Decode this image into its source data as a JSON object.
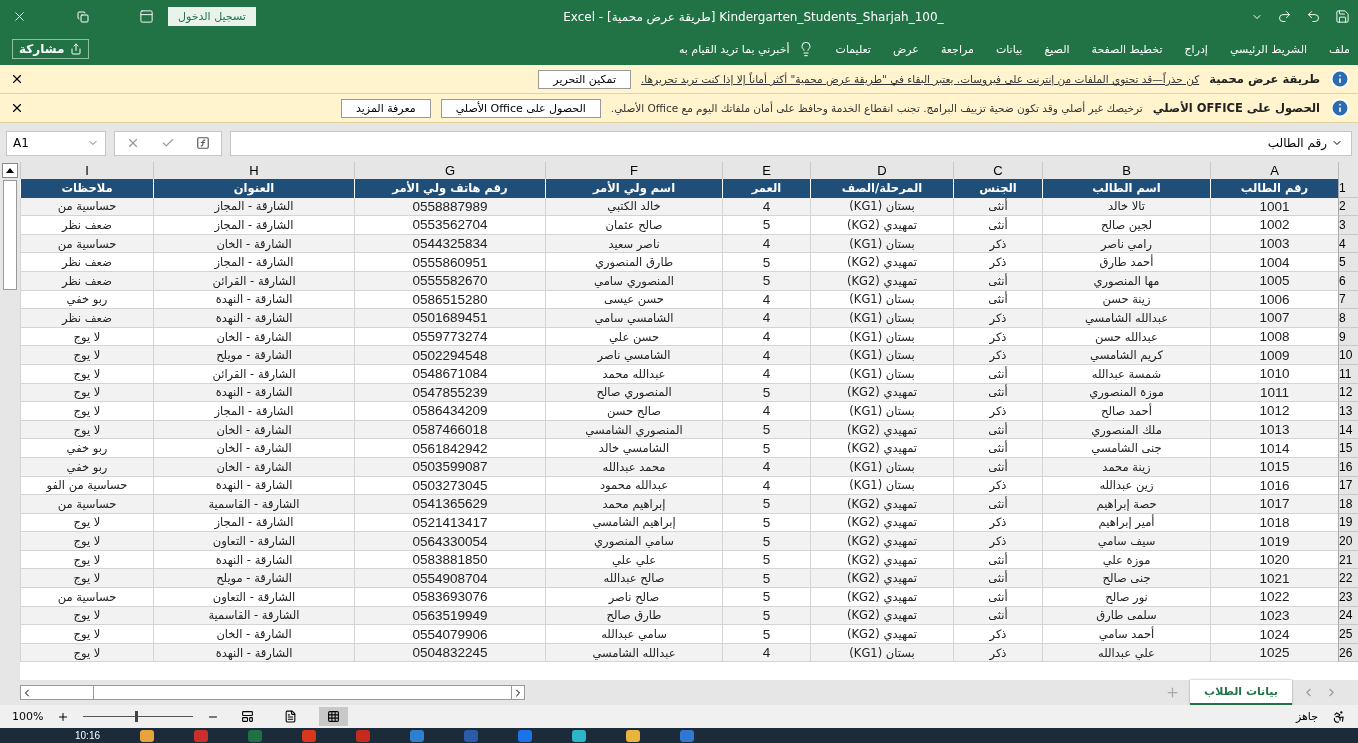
{
  "window": {
    "title": "Excel - [طريقة عرض محمية] Kindergarten_Students_Sharjah_100_",
    "sign_in": "تسجيل الدخول"
  },
  "ribbon": {
    "tabs": [
      "ملف",
      "الشريط الرئيسي",
      "إدراج",
      "تخطيط الصفحة",
      "الصيغ",
      "بيانات",
      "مراجعة",
      "عرض",
      "تعليمات"
    ],
    "tell_me": "أخبرني بما تريد القيام به",
    "share": "مشاركة"
  },
  "message_bars": [
    {
      "title": "طريقة عرض محمية",
      "message": "كن حذراً—قد تحتوي الملفات من إنترنت على فيروسات. يعتبر البقاء في \"طريقة عرض محمية\" أكثر أماناً إلا إذا كنت تريد تحريرها.",
      "link": true,
      "buttons": [
        "تمكين التحرير"
      ]
    },
    {
      "title": "الحصول على OFFICE الأصلي",
      "message": "ترخيصك غير أصلي وقد تكون ضحية تزييف البرامج. تجنب انقطاع الخدمة وحافظ على أمان ملفاتك اليوم مع Office الأصلي.",
      "link": false,
      "buttons": [
        "الحصول على Office الأصلي",
        "معرفة المزيد"
      ]
    }
  ],
  "formula_bar": {
    "name_box": "A1",
    "formula": "رقم الطالب"
  },
  "sheet": {
    "columns": [
      {
        "letter": "A",
        "header": "رقم الطالب"
      },
      {
        "letter": "B",
        "header": "اسم الطالب"
      },
      {
        "letter": "C",
        "header": "الجنس"
      },
      {
        "letter": "D",
        "header": "المرحلة/الصف"
      },
      {
        "letter": "E",
        "header": "العمر"
      },
      {
        "letter": "F",
        "header": "اسم ولي الأمر"
      },
      {
        "letter": "G",
        "header": "رقم هاتف ولي الأمر"
      },
      {
        "letter": "H",
        "header": "العنوان"
      },
      {
        "letter": "I",
        "header": "ملاحظات"
      }
    ],
    "header_row": "1",
    "rows": [
      {
        "number": "2",
        "cells": [
          "1001",
          "تالا خالد",
          "أنثى",
          "بستان (KG1)",
          "4",
          "خالد الكتبي",
          "0558887989",
          "الشارقة - المجاز",
          "حساسية من"
        ]
      },
      {
        "number": "3",
        "cells": [
          "1002",
          "لجين صالح",
          "أنثى",
          "تمهيدي (KG2)",
          "5",
          "صالح عثمان",
          "0553562704",
          "الشارقة - المجاز",
          "ضعف نظر"
        ]
      },
      {
        "number": "4",
        "cells": [
          "1003",
          "رامي ناصر",
          "ذكر",
          "بستان (KG1)",
          "4",
          "ناصر سعيد",
          "0544325834",
          "الشارقة - الخان",
          "حساسية من"
        ]
      },
      {
        "number": "5",
        "cells": [
          "1004",
          "أحمد طارق",
          "ذكر",
          "تمهيدي (KG2)",
          "5",
          "طارق المنصوري",
          "0555860951",
          "الشارقة - المجاز",
          "ضعف نظر"
        ]
      },
      {
        "number": "6",
        "cells": [
          "1005",
          "مها المنصوري",
          "أنثى",
          "تمهيدي (KG2)",
          "5",
          "المنصوري سامي",
          "0555582670",
          "الشارقة - القرائن",
          "ضعف نظر"
        ]
      },
      {
        "number": "7",
        "cells": [
          "1006",
          "زينة حسن",
          "أنثى",
          "بستان (KG1)",
          "4",
          "حسن عيسى",
          "0586515280",
          "الشارقة - النهدة",
          "ربو خفي"
        ]
      },
      {
        "number": "8",
        "cells": [
          "1007",
          "عبدالله الشامسي",
          "ذكر",
          "بستان (KG1)",
          "4",
          "الشامسي سامي",
          "0501689451",
          "الشارقة - النهدة",
          "ضعف نظر"
        ]
      },
      {
        "number": "9",
        "cells": [
          "1008",
          "عبدالله حسن",
          "ذكر",
          "بستان (KG1)",
          "4",
          "حسن علي",
          "0559773274",
          "الشارقة - الخان",
          "لا يوج"
        ]
      },
      {
        "number": "10",
        "cells": [
          "1009",
          "كريم الشامسي",
          "ذكر",
          "بستان (KG1)",
          "4",
          "الشامسي ناصر",
          "0502294548",
          "الشارقة - مويلح",
          "لا يوج"
        ]
      },
      {
        "number": "11",
        "cells": [
          "1010",
          "شمسة عبدالله",
          "أنثى",
          "بستان (KG1)",
          "4",
          "عبدالله محمد",
          "0548671084",
          "الشارقة - القرائن",
          "لا يوج"
        ]
      },
      {
        "number": "12",
        "cells": [
          "1011",
          "موزة المنصوري",
          "أنثى",
          "تمهيدي (KG2)",
          "5",
          "المنصوري صالح",
          "0547855239",
          "الشارقة - النهدة",
          "لا يوج"
        ]
      },
      {
        "number": "13",
        "cells": [
          "1012",
          "أحمد صالح",
          "ذكر",
          "بستان (KG1)",
          "4",
          "صالح حسن",
          "0586434209",
          "الشارقة - المجاز",
          "لا يوج"
        ]
      },
      {
        "number": "14",
        "cells": [
          "1013",
          "ملك المنصوري",
          "أنثى",
          "تمهيدي (KG2)",
          "5",
          "المنصوري الشامسي",
          "0587466018",
          "الشارقة - الخان",
          "لا يوج"
        ]
      },
      {
        "number": "15",
        "cells": [
          "1014",
          "جنى الشامسي",
          "أنثى",
          "تمهيدي (KG2)",
          "5",
          "الشامسي خالد",
          "0561842942",
          "الشارقة - الخان",
          "ربو خفي"
        ]
      },
      {
        "number": "16",
        "cells": [
          "1015",
          "زينة محمد",
          "أنثى",
          "بستان (KG1)",
          "4",
          "محمد عبدالله",
          "0503599087",
          "الشارقة - الخان",
          "ربو خفي"
        ]
      },
      {
        "number": "17",
        "cells": [
          "1016",
          "زين عبدالله",
          "ذكر",
          "بستان (KG1)",
          "4",
          "عبدالله محمود",
          "0503273045",
          "الشارقة - النهدة",
          "حساسية من الفو"
        ]
      },
      {
        "number": "18",
        "cells": [
          "1017",
          "حصة إبراهيم",
          "أنثى",
          "تمهيدي (KG2)",
          "5",
          "إبراهيم محمد",
          "0541365629",
          "الشارقة - القاسمية",
          "حساسية من"
        ]
      },
      {
        "number": "19",
        "cells": [
          "1018",
          "أمير إبراهيم",
          "ذكر",
          "تمهيدي (KG2)",
          "5",
          "إبراهيم الشامسي",
          "0521413417",
          "الشارقة - المجاز",
          "لا يوج"
        ]
      },
      {
        "number": "20",
        "cells": [
          "1019",
          "سيف سامي",
          "ذكر",
          "تمهيدي (KG2)",
          "5",
          "سامي المنصوري",
          "0564330054",
          "الشارقة - التعاون",
          "لا يوج"
        ]
      },
      {
        "number": "21",
        "cells": [
          "1020",
          "موزة علي",
          "أنثى",
          "تمهيدي (KG2)",
          "5",
          "علي علي",
          "0583881850",
          "الشارقة - النهدة",
          "لا يوج"
        ]
      },
      {
        "number": "22",
        "cells": [
          "1021",
          "جنى صالح",
          "أنثى",
          "تمهيدي (KG2)",
          "5",
          "صالح عبدالله",
          "0554908704",
          "الشارقة - مويلح",
          "لا يوج"
        ]
      },
      {
        "number": "23",
        "cells": [
          "1022",
          "نور صالح",
          "أنثى",
          "تمهيدي (KG2)",
          "5",
          "صالح ناصر",
          "0583693076",
          "الشارقة - التعاون",
          "حساسية من"
        ]
      },
      {
        "number": "24",
        "cells": [
          "1023",
          "سلمى طارق",
          "أنثى",
          "تمهيدي (KG2)",
          "5",
          "طارق صالح",
          "0563519949",
          "الشارقة - القاسمية",
          "لا يوج"
        ]
      },
      {
        "number": "25",
        "cells": [
          "1024",
          "أحمد سامي",
          "ذكر",
          "تمهيدي (KG2)",
          "5",
          "سامي عبدالله",
          "0554079906",
          "الشارقة - الخان",
          "لا يوج"
        ]
      },
      {
        "number": "26",
        "cells": [
          "1025",
          "علي عبدالله",
          "ذكر",
          "بستان (KG1)",
          "4",
          "عبدالله الشامسي",
          "0504832245",
          "الشارقة - النهدة",
          "لا يوج"
        ]
      }
    ]
  },
  "sheet_tabs": [
    {
      "label": "بيانات الطلاب",
      "selected": true
    }
  ],
  "status_bar": {
    "status": "جاهز",
    "zoom": {
      "reading": "100%",
      "level": 0.5
    }
  },
  "taskbar": {
    "time": "10:16"
  }
}
